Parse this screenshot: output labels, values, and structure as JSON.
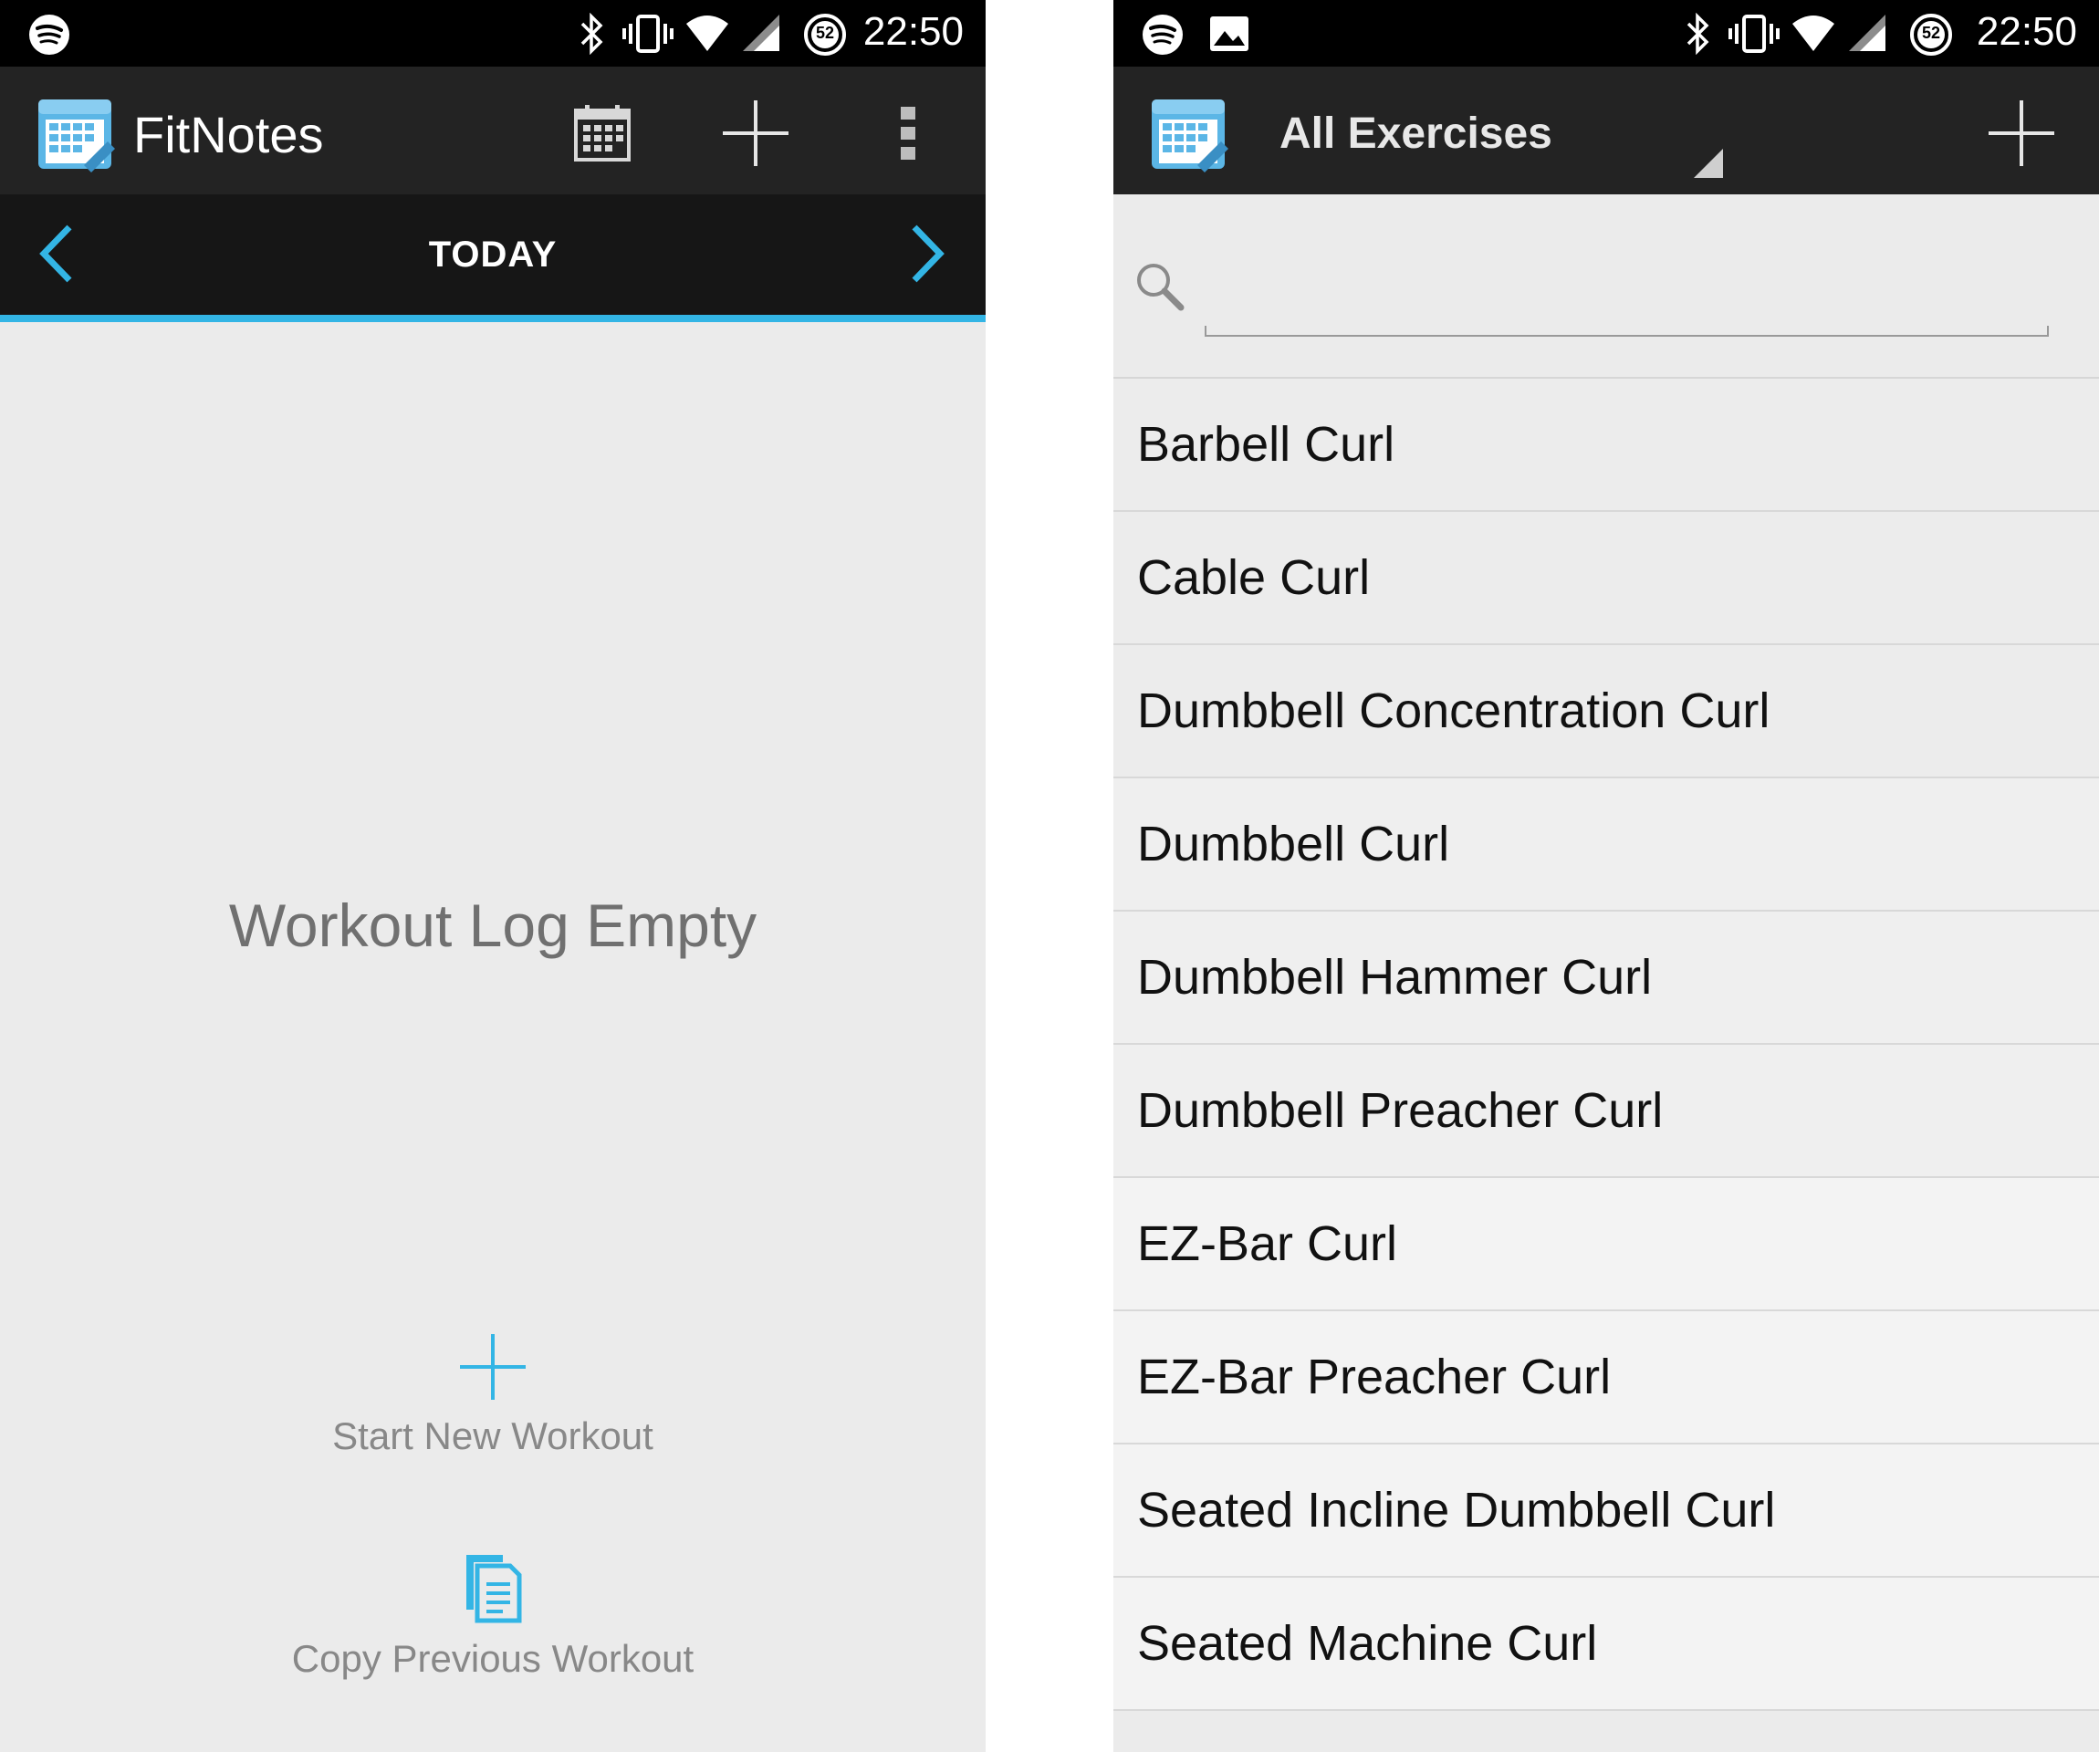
{
  "left": {
    "status": {
      "time": "22:50",
      "battery_level": "52"
    },
    "actionbar": {
      "title": "FitNotes"
    },
    "datenav": {
      "label": "TODAY"
    },
    "empty_message": "Workout Log Empty",
    "actions": {
      "start_new": "Start New Workout",
      "copy_previous": "Copy Previous Workout"
    }
  },
  "right": {
    "status": {
      "time": "22:50",
      "battery_level": "52"
    },
    "actionbar": {
      "title": "All Exercises"
    },
    "search": {
      "value": "",
      "placeholder": ""
    },
    "exercises": [
      "Barbell Curl",
      "Cable Curl",
      "Dumbbell Concentration Curl",
      "Dumbbell Curl",
      "Dumbbell Hammer Curl",
      "Dumbbell Preacher Curl",
      "EZ-Bar Curl",
      "EZ-Bar Preacher Curl",
      "Seated Incline Dumbbell Curl",
      "Seated Machine Curl"
    ]
  },
  "colors": {
    "accent": "#33b5e5",
    "actionbar_bg": "#232323",
    "datenav_bg": "#161616",
    "content_bg": "#ebebeb"
  },
  "icons": {
    "logo": "fitnotes-logo-icon",
    "calendar": "calendar-icon",
    "add": "plus-icon",
    "overflow": "overflow-menu-icon",
    "prev": "chevron-left-icon",
    "next": "chevron-right-icon",
    "search": "search-icon",
    "copy": "copy-icon"
  }
}
